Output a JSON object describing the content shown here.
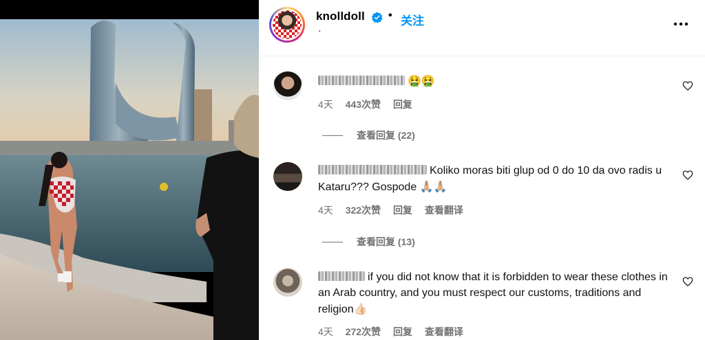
{
  "post": {
    "username": "knolldoll",
    "follow_label": "关注",
    "dot": "•",
    "subline": "·"
  },
  "comments": [
    {
      "text": "",
      "emoji": "🤮🤮",
      "time": "4天",
      "likes": "443次赞",
      "reply": "回复",
      "translate": "",
      "view_replies": "查看回复 (22)"
    },
    {
      "text": "Koliko moras biti glup od 0 do 10 da ovo radis u Kataru??? Gospode",
      "emoji": "🙏🏼🙏🏼",
      "time": "4天",
      "likes": "322次赞",
      "reply": "回复",
      "translate": "查看翻译",
      "view_replies": "查看回复 (13)"
    },
    {
      "text": "if you did not know that it is forbidden to wear these clothes in an Arab country, and you must respect our customs, traditions and religion",
      "emoji": "👍🏻",
      "time": "4天",
      "likes": "272次赞",
      "reply": "回复",
      "translate": "查看翻译",
      "view_replies": ""
    }
  ],
  "icons": {
    "verified": "verified-badge-icon",
    "more": "more-options-icon",
    "like": "heart-outline-icon"
  },
  "colors": {
    "accent": "#0095f6",
    "muted": "#737373",
    "verified": "#0095f6"
  }
}
